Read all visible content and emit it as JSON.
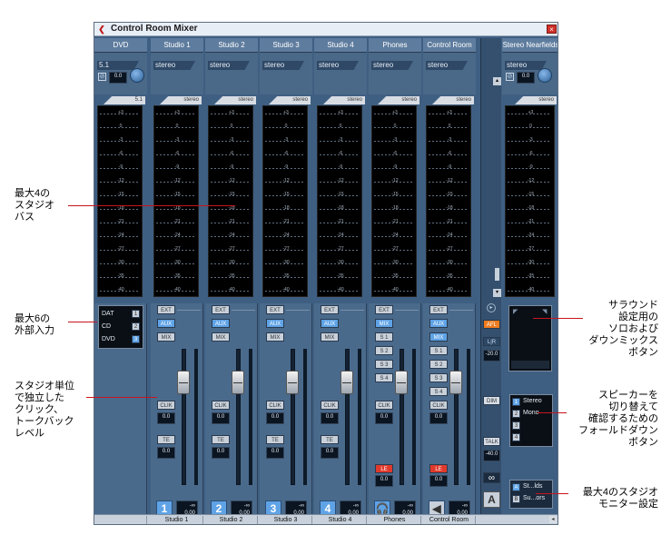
{
  "window": {
    "title": "Control Room Mixer",
    "close_label": "×",
    "footer_left": "▸",
    "footer_right": "◂"
  },
  "channels": [
    {
      "name": "DVD",
      "mode": "5.1",
      "fmt": "5.1",
      "num": "",
      "footer": ""
    },
    {
      "name": "Studio 1",
      "mode": "stereo",
      "fmt": "stereo",
      "num": "1",
      "footer": "Studio 1"
    },
    {
      "name": "Studio 2",
      "mode": "stereo",
      "fmt": "stereo",
      "num": "2",
      "footer": "Studio 2"
    },
    {
      "name": "Studio 3",
      "mode": "stereo",
      "fmt": "stereo",
      "num": "3",
      "footer": "Studio 3"
    },
    {
      "name": "Studio 4",
      "mode": "stereo",
      "fmt": "stereo",
      "num": "4",
      "footer": "Studio 4"
    },
    {
      "name": "Phones",
      "mode": "stereo",
      "fmt": "stereo",
      "num": "🎧",
      "footer": "Phones"
    },
    {
      "name": "Control Room",
      "mode": "stereo",
      "fmt": "stereo",
      "num": "◀",
      "footer": "Control Room"
    }
  ],
  "dvd_gain": "0.0",
  "right_channel": {
    "name": "Stereo Nearfields",
    "mode": "stereo",
    "fmt": "stereo",
    "gain": "0.0"
  },
  "meter_labels": [
    "+3",
    "0",
    "-3",
    "-6",
    "-9",
    "-12",
    "-15",
    "-18",
    "-21",
    "-24",
    "-27",
    "-30",
    "-35",
    "-40"
  ],
  "inputs": {
    "items": [
      "DAT",
      "CD",
      "DVD"
    ],
    "nums": [
      "1",
      "2",
      "3"
    ]
  },
  "strip_labels": {
    "ext": "EXT",
    "aux": "AUX",
    "mix": "MIX",
    "clik": "CLIK",
    "te": "TE",
    "le": "LE",
    "s1": "S 1",
    "s2": "S 2",
    "s3": "S 3",
    "s4": "S 4"
  },
  "values": {
    "zero": "0.0",
    "neg_inf": "-∞",
    "bottom_val": "0.00"
  },
  "cr_panel": {
    "afl": "AFL",
    "lr": "L|R",
    "afl_val": "-20.0",
    "dim": "DIM",
    "talk": "TALK",
    "talk_val": "-40.0",
    "link": "∞",
    "a_btn": "A"
  },
  "speakers": {
    "nums": [
      "1",
      "2",
      "3",
      "4"
    ],
    "items": [
      "Stereo",
      "Mono"
    ]
  },
  "monitors": {
    "letters": [
      "A",
      "B"
    ],
    "items": [
      "St...lds",
      "Su...ors"
    ]
  },
  "annotations": {
    "studio_bus": "最大4の\nスタジオ\nバス",
    "ext_inputs": "最大6の\n外部入力",
    "studio_indep": "スタジオ単位\nで独立した\nクリック、\nトークバック\nレベル",
    "surround": "サラウンド\n設定用の\nソロおよび\nダウンミックス\nボタン",
    "speaker": "スピーカーを\n切り替えて\n確認するための\nフォールドダウン\nボタン",
    "monitor": "最大4のスタジオ\nモニター設定"
  }
}
